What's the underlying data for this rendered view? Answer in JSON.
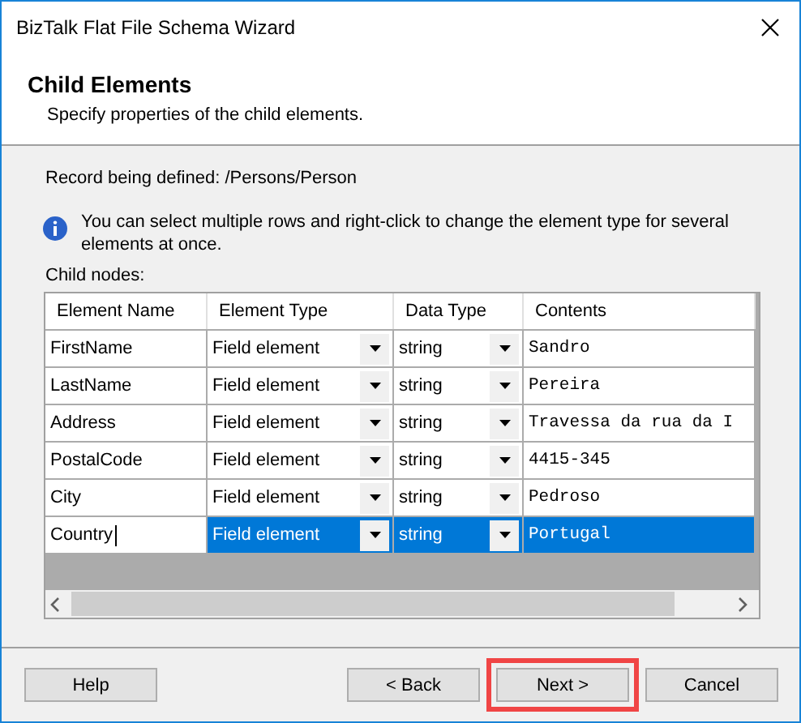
{
  "window": {
    "title": "BizTalk Flat File Schema Wizard"
  },
  "header": {
    "title": "Child Elements",
    "subtitle": "Specify properties of the child elements."
  },
  "record_label": "Record being defined: /Persons/Person",
  "info": "You can select multiple rows and right-click to change the element type for several elements at once.",
  "child_nodes_label": "Child nodes:",
  "table": {
    "columns": [
      "Element Name",
      "Element Type",
      "Data Type",
      "Contents"
    ],
    "rows": [
      {
        "name": "FirstName",
        "element_type": "Field element",
        "data_type": "string",
        "contents": "Sandro",
        "selected": false,
        "editing": false
      },
      {
        "name": "LastName",
        "element_type": "Field element",
        "data_type": "string",
        "contents": "Pereira",
        "selected": false,
        "editing": false
      },
      {
        "name": "Address",
        "element_type": "Field element",
        "data_type": "string",
        "contents": "Travessa da rua da I",
        "selected": false,
        "editing": false
      },
      {
        "name": "PostalCode",
        "element_type": "Field element",
        "data_type": "string",
        "contents": "4415-345",
        "selected": false,
        "editing": false
      },
      {
        "name": "City",
        "element_type": "Field element",
        "data_type": "string",
        "contents": "Pedroso",
        "selected": false,
        "editing": false
      },
      {
        "name": "Country",
        "element_type": "Field element",
        "data_type": "string",
        "contents": "Portugal",
        "selected": true,
        "editing": true
      }
    ]
  },
  "buttons": [
    {
      "label": "Help",
      "highlighted": false
    },
    {
      "label": "< Back",
      "highlighted": false
    },
    {
      "label": "Next >",
      "highlighted": true
    },
    {
      "label": "Cancel",
      "highlighted": false
    }
  ]
}
